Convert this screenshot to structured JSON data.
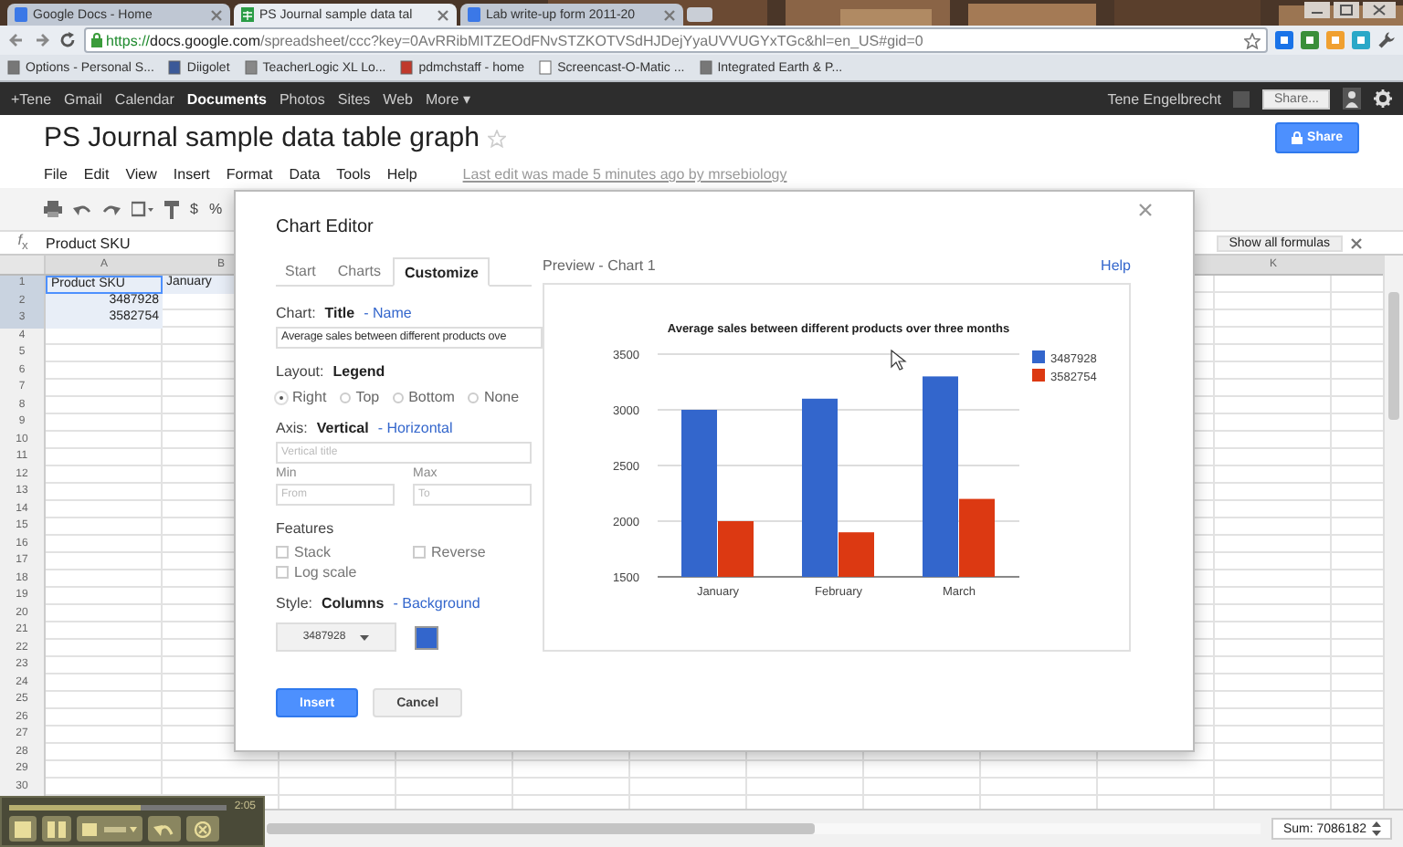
{
  "browser": {
    "tabs": [
      {
        "title": "Google Docs - Home",
        "selected": false
      },
      {
        "title": "PS Journal sample data tal",
        "selected": true
      },
      {
        "title": "Lab write-up form 2011-20",
        "selected": false
      }
    ],
    "url": {
      "scheme": "https://",
      "host": "docs.google.com",
      "path": "/spreadsheet/ccc?key=0AvRRibMITZEOdFNvSTZKOTVSdHJDejYyaUVVUGYxTGc&hl=en_US#gid=0"
    },
    "bookmarks": [
      "Options - Personal S...",
      "Diigolet",
      "TeacherLogic XL Lo...",
      "pdmchstaff - home",
      "Screencast-O-Matic ...",
      "Integrated Earth & P..."
    ]
  },
  "google_bar": {
    "links": [
      {
        "label": "+Tene",
        "selected": false
      },
      {
        "label": "Gmail",
        "selected": false
      },
      {
        "label": "Calendar",
        "selected": false
      },
      {
        "label": "Documents",
        "selected": true
      },
      {
        "label": "Photos",
        "selected": false
      },
      {
        "label": "Sites",
        "selected": false
      },
      {
        "label": "Web",
        "selected": false
      },
      {
        "label": "More ▾",
        "selected": false
      }
    ],
    "user": "Tene Engelbrecht",
    "share": "Share..."
  },
  "document": {
    "title": "PS Journal sample data table graph",
    "share": "Share",
    "menu": [
      "File",
      "Edit",
      "View",
      "Insert",
      "Format",
      "Data",
      "Tools",
      "Help"
    ],
    "last_edit": "Last edit was made 5 minutes ago by mrsebiology"
  },
  "toolbar": {
    "texts": [
      "$",
      "%"
    ]
  },
  "formula_bar": {
    "label": "*f*$_{x}$",
    "value": "Product SKU",
    "show_formulas": "Show all formulas"
  },
  "sheet": {
    "left_columns": [
      "A",
      "B"
    ],
    "right_columns": [
      "K"
    ],
    "rows": [
      {
        "number": "1",
        "selected": true,
        "cells": [
          {
            "text": "Product SKU",
            "kind": "text",
            "active": true
          },
          {
            "text": "January",
            "kind": "text",
            "active": false
          }
        ]
      },
      {
        "number": "2",
        "selected": true,
        "cells": [
          {
            "text": "3487928",
            "kind": "number",
            "active": false
          }
        ]
      },
      {
        "number": "3",
        "selected": true,
        "cells": [
          {
            "text": "3582754",
            "kind": "number",
            "active": false
          }
        ]
      },
      {
        "number": "4",
        "selected": false
      },
      {
        "number": "5",
        "selected": false
      },
      {
        "number": "6",
        "selected": false
      },
      {
        "number": "7",
        "selected": false
      },
      {
        "number": "8",
        "selected": false
      },
      {
        "number": "9",
        "selected": false
      },
      {
        "number": "10",
        "selected": false
      },
      {
        "number": "11",
        "selected": false
      },
      {
        "number": "12",
        "selected": false
      },
      {
        "number": "13",
        "selected": false
      },
      {
        "number": "14",
        "selected": false
      },
      {
        "number": "15",
        "selected": false
      },
      {
        "number": "16",
        "selected": false
      },
      {
        "number": "17",
        "selected": false
      },
      {
        "number": "18",
        "selected": false
      },
      {
        "number": "19",
        "selected": false
      },
      {
        "number": "20",
        "selected": false
      },
      {
        "number": "21",
        "selected": false
      },
      {
        "number": "22",
        "selected": false
      },
      {
        "number": "23",
        "selected": false
      },
      {
        "number": "24",
        "selected": false
      },
      {
        "number": "25",
        "selected": false
      },
      {
        "number": "26",
        "selected": false
      },
      {
        "number": "27",
        "selected": false
      },
      {
        "number": "28",
        "selected": false
      },
      {
        "number": "29",
        "selected": false
      },
      {
        "number": "30",
        "selected": false
      }
    ]
  },
  "status": {
    "sum": "Sum: 7086182"
  },
  "recorder": {
    "level": 0.6,
    "time": "2:05"
  },
  "chart_editor": {
    "title": "Chart Editor",
    "tabs": [
      {
        "label": "Start",
        "selected": false
      },
      {
        "label": "Charts",
        "selected": false
      },
      {
        "label": "Customize",
        "selected": true
      }
    ],
    "sections": [
      {
        "kind": "title",
        "label": "Chart:",
        "options": [
          {
            "label": "Title",
            "selected": true
          },
          {
            "label": "- Name",
            "selected": false
          }
        ],
        "value": "Average sales between different products ove"
      },
      {
        "kind": "legend",
        "label": "Layout:",
        "options": [
          {
            "label": "Legend",
            "selected": true
          }
        ],
        "radios": [
          {
            "label": "Right",
            "selected": true
          },
          {
            "label": "Top",
            "selected": false
          },
          {
            "label": "Bottom",
            "selected": false
          },
          {
            "label": "None",
            "selected": false
          }
        ]
      },
      {
        "kind": "axis",
        "label": "Axis:",
        "options": [
          {
            "label": "Vertical",
            "selected": true
          },
          {
            "label": "- Horizontal",
            "selected": false
          }
        ],
        "title_placeholder": "Vertical title",
        "min": {
          "label": "Min",
          "placeholder": "From"
        },
        "max": {
          "label": "Max",
          "placeholder": "To"
        }
      },
      {
        "kind": "features",
        "label": "Features",
        "checkboxes": [
          {
            "label": "Stack",
            "checked": false
          },
          {
            "label": "Reverse",
            "checked": false
          },
          {
            "label": "Log scale",
            "checked": false
          }
        ]
      },
      {
        "kind": "style",
        "label": "Style:",
        "options": [
          {
            "label": "Columns",
            "selected": true
          },
          {
            "label": "- Background",
            "selected": false
          }
        ],
        "series": "3487928",
        "color": "#3366cc"
      }
    ],
    "buttons": [
      {
        "label": "Insert",
        "kind": "primary"
      },
      {
        "label": "Cancel",
        "kind": "secondary"
      }
    ],
    "preview": {
      "label": "Preview - Chart 1",
      "help": "Help",
      "chart_data": {
        "type": "bar",
        "title": "Average sales between different products over three months",
        "categories": [
          "January",
          "February",
          "March"
        ],
        "series": [
          {
            "name": "3487928",
            "color": "#3366cc",
            "values": [
              3000,
              3100,
              3300
            ]
          },
          {
            "name": "3582754",
            "color": "#dc3912",
            "values": [
              2000,
              1900,
              2200
            ]
          }
        ],
        "ylim": [
          1500,
          3500
        ],
        "yticks": [
          1500,
          2000,
          2500,
          3000,
          3500
        ],
        "grid": true,
        "legend": "right"
      }
    }
  }
}
